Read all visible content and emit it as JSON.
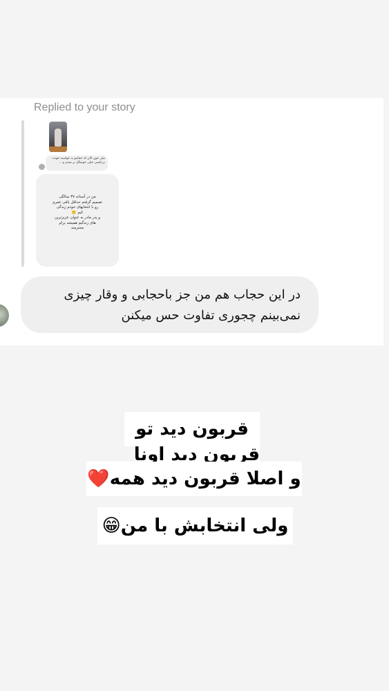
{
  "reply_header": {
    "text": "Replied to your story"
  },
  "story_reply": {
    "mini_message": "نیلی جون الان که حجابتو به خواسته خودت برداشتی خیلی خوشگل تر شدی و ... ",
    "card_lines": [
      "من در آستانه ۳۷ سالگی",
      "تصمیم گرفتم حداقل باقی عمرم",
      "رو با انتخابهای خودم زندگی",
      "کنم 🙂",
      "و پدر مادر به عنوان عزیزترین",
      "های زندگیم همیشه برام",
      "محترمند"
    ]
  },
  "message": {
    "lines": [
      "در این حجاب هم من جز  باحجابی و وقار چیزی",
      "نمی‌بینم چجوری تفاوت حس میکنن"
    ]
  },
  "captions": {
    "line1": "قربون دید تو",
    "line2": "قربون دید اونا",
    "line3": "و اصلا قربون دید همه",
    "line3_emoji": "❤️",
    "line4": "ولی انتخابش با من",
    "line4_emoji": "😁"
  },
  "colors": {
    "background": "#f4f4f4",
    "card": "#ffffff",
    "bubble": "#efefef",
    "muted_text": "#8e8e8e",
    "heart": "#e0242b"
  }
}
